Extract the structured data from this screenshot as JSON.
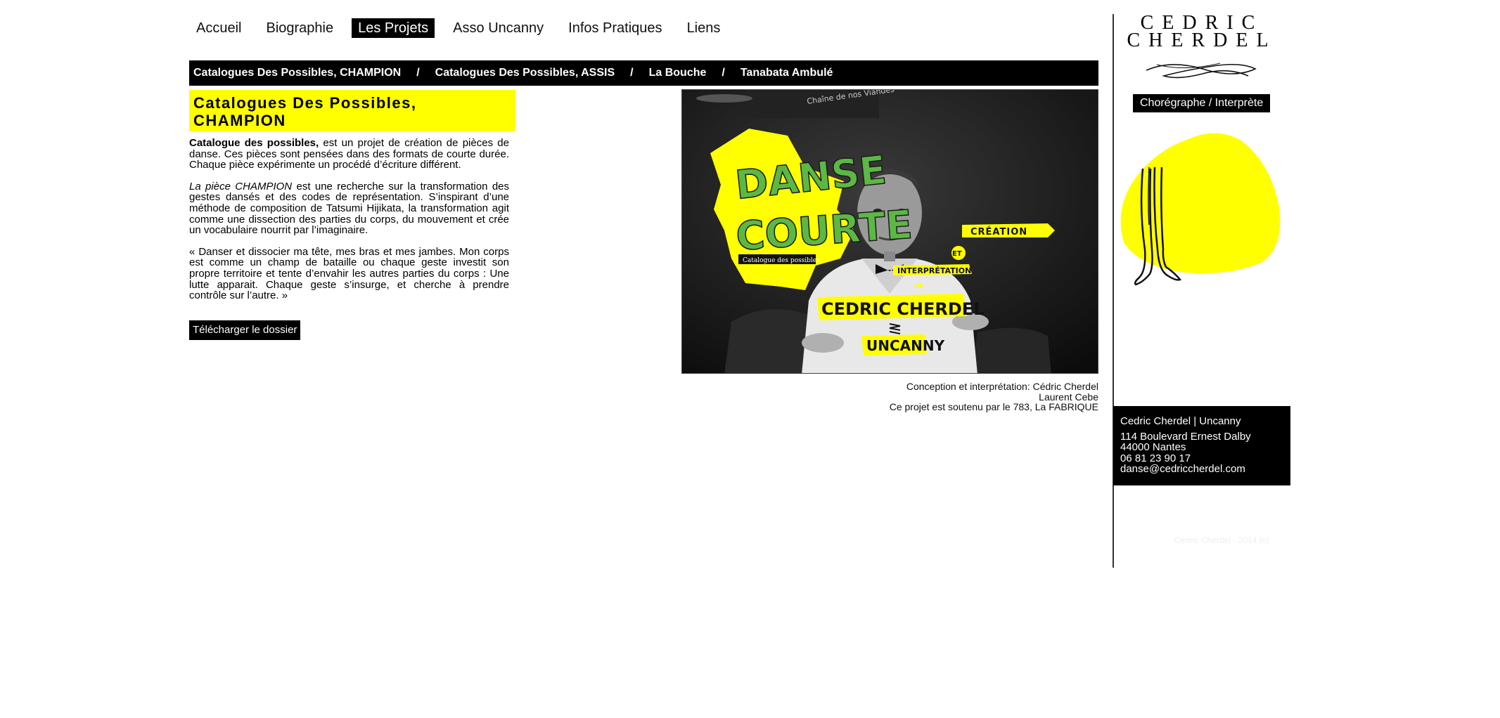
{
  "nav": {
    "items": [
      {
        "label": "Accueil",
        "active": false
      },
      {
        "label": "Biographie",
        "active": false
      },
      {
        "label": "Les Projets",
        "active": true
      },
      {
        "label": "Asso Uncanny",
        "active": false
      },
      {
        "label": "Infos Pratiques",
        "active": false
      },
      {
        "label": "Liens",
        "active": false
      }
    ]
  },
  "subnav": {
    "items": [
      "Catalogues Des Possibles, CHAMPION",
      "Catalogues Des Possibles, ASSIS",
      "La Bouche",
      "Tanabata Ambulé"
    ],
    "separator": "/"
  },
  "article": {
    "title_line1": "Catalogues Des Possibles,",
    "title_line2": "CHAMPION",
    "p1_bold": "Catalogue des possibles,",
    "p1_rest": " est un projet de création de pièces de danse. Ces pièces sont pensées dans des formats de courte durée. Chaque pièce expérimente un procédé d’écriture différent.",
    "p2_italic": "La pièce CHAMPION",
    "p2_rest": " est une recherche sur la transformation des gestes dansés et des codes de représentation. S’inspirant d’une méthode de composition de Tatsumi Hijikata, la transformation agit comme une dissection des parties du corps, du mouvement et crée un vocabulaire nourrit par l’imaginaire.",
    "p3": "« Danser et dissocier ma tête, mes bras et mes jambes. Mon corps est comme un champ de bataille ou chaque geste investit son propre territoire et tente d’envahir les autres parties du corps : Une lutte apparait. Chaque geste s’insurge, et cherche à prendre contrôle sur l’autre. »",
    "download_label": "Télécharger le dossier"
  },
  "poster": {
    "sign": "Chaîne de nos Viandes",
    "title_line1": "DANSE",
    "title_line2": "COURTE",
    "subtitle": "Catalogue des possibles",
    "creation": "CRÉATION",
    "et": "ET",
    "interpretation": "INTERPRÉTATION",
    "de": "DE",
    "name": "CEDRIC CHERDEL",
    "company": "UNCANNY"
  },
  "credits": {
    "line1": "Conception et interprétation: Cédric Cherdel",
    "line2": "Laurent Cebe",
    "line3": "Ce projet est soutenu par le 783, La FABRIQUE"
  },
  "brand": {
    "first": "CEDRIC",
    "last": "CHERDEL",
    "role": "Chorégraphe / Interprète"
  },
  "contact": {
    "org": "Cedric Cherdel | Uncanny",
    "address": "114 Boulevard Ernest Dalby",
    "city": "44000 Nantes",
    "phone": "06 81 23 90 17",
    "email": "danse@cedriccherdel.com"
  },
  "footer": {
    "note": "Cedric Cherdel - 2014 (c)"
  },
  "colors": {
    "accent_yellow": "#ffff00",
    "black": "#000000"
  }
}
